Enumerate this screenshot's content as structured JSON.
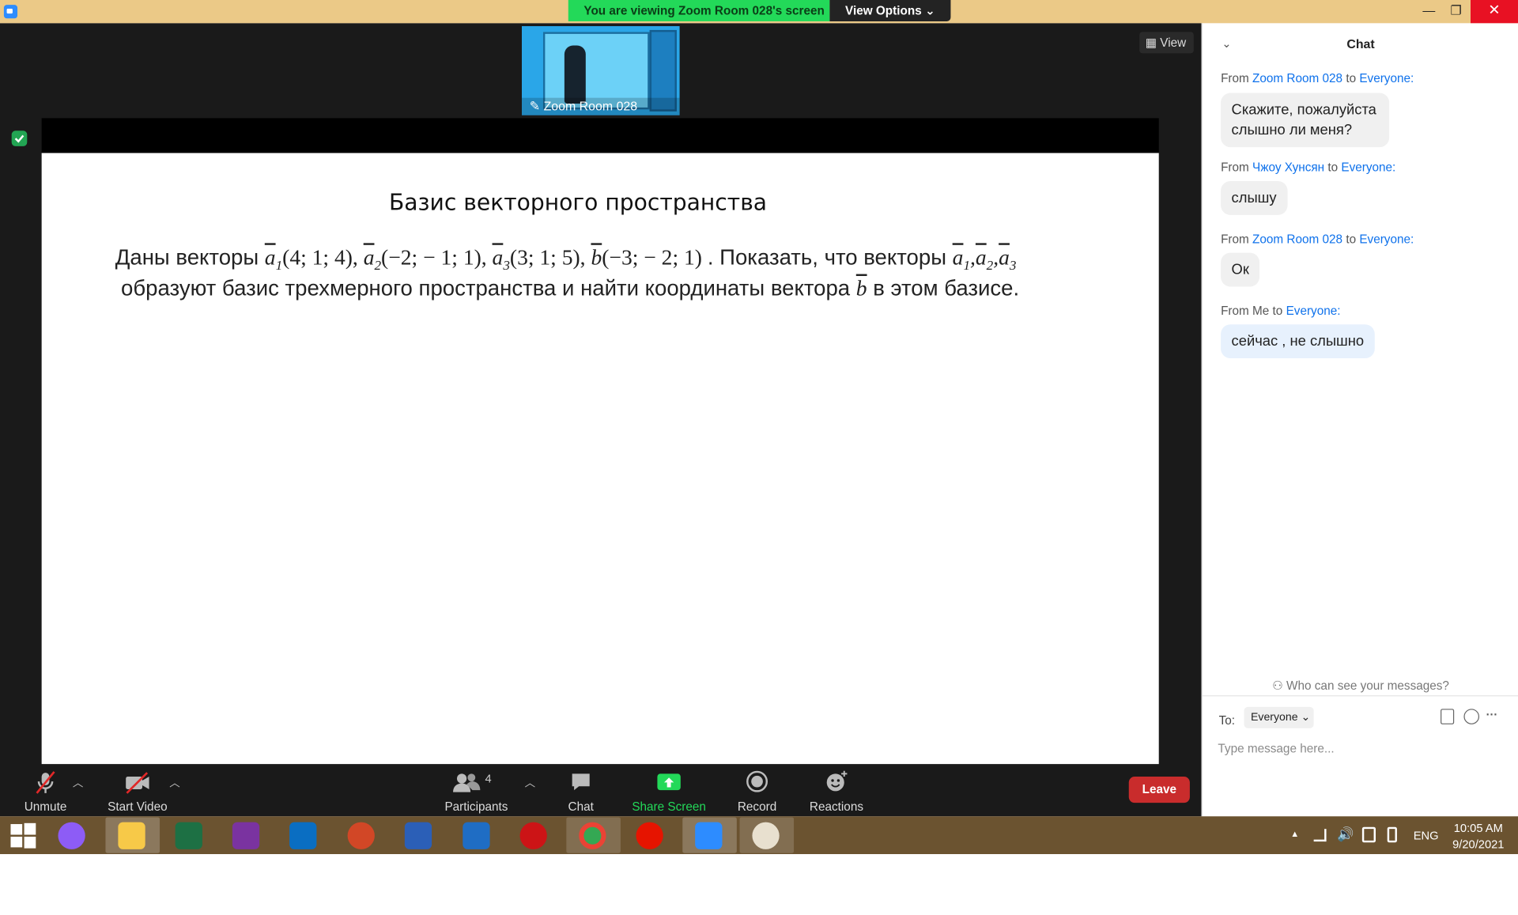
{
  "titlebar": {
    "banner": "You are viewing Zoom Room 028's screen",
    "view_options": "View Options ⌄",
    "minimize": "—",
    "maximize": "❐",
    "close": "✕"
  },
  "meeting": {
    "thumb_label": "Zoom Room 028",
    "view_label": "View"
  },
  "slide": {
    "title": "Базис векторного пространства",
    "l1_a": "Даны векторы ",
    "a1": "a",
    "a1_sub": "1",
    "a1_coords": "(4; 1; 4), ",
    "a2": "a",
    "a2_sub": "2",
    "a2_coords": "(−2; − 1; 1), ",
    "a3": "a",
    "a3_sub": "3",
    "a3_coords": "(3; 1; 5), ",
    "b": "b",
    "b_coords": "(−3; − 2; 1) ",
    "l1_b": ". Показать, что векторы ",
    "v1": "a",
    "v1_sub": "1",
    "v2": "a",
    "v2_sub": "2",
    "v3": "a",
    "v3_sub": "3",
    "comma": ",",
    "l2_a": "образуют базис трехмерного пространства и найти координаты вектора ",
    "l2_b": "b",
    "l2_c": "  в этом базисе."
  },
  "toolbar": {
    "unmute": "Unmute",
    "start_video": "Start Video",
    "participants": "Participants",
    "participants_count": "4",
    "chat": "Chat",
    "share_screen": "Share Screen",
    "record": "Record",
    "reactions": "Reactions",
    "leave": "Leave"
  },
  "chat": {
    "header": "Chat",
    "messages": [
      {
        "from_prefix": "From ",
        "from": "Zoom Room 028",
        "to_prefix": " to ",
        "to": "Everyone:",
        "text": "Скажите, пожалуйста слышно ли меня?"
      },
      {
        "from_prefix": "From ",
        "from": "Чжоу Хунсян",
        "to_prefix": " to ",
        "to": "Everyone:",
        "text": "слышу"
      },
      {
        "from_prefix": "From ",
        "from": "Zoom Room 028",
        "to_prefix": " to ",
        "to": "Everyone:",
        "text": "Ок"
      },
      {
        "from_prefix": "From Me to ",
        "to": "Everyone:",
        "text": "сейчас , не слышно"
      }
    ],
    "who_can_see": "Who can see your messages?",
    "to_label": "To:",
    "to_value": "Everyone",
    "placeholder": "Type message here...",
    "more": "···"
  },
  "taskbar": {
    "lang": "ENG",
    "time": "10:05 AM",
    "date": "9/20/2021",
    "tray_up": "▲"
  },
  "colors": {
    "accent": "#0e71eb",
    "leave": "#c92c2c",
    "share": "#23d959",
    "titlebar": "#ebc987"
  }
}
